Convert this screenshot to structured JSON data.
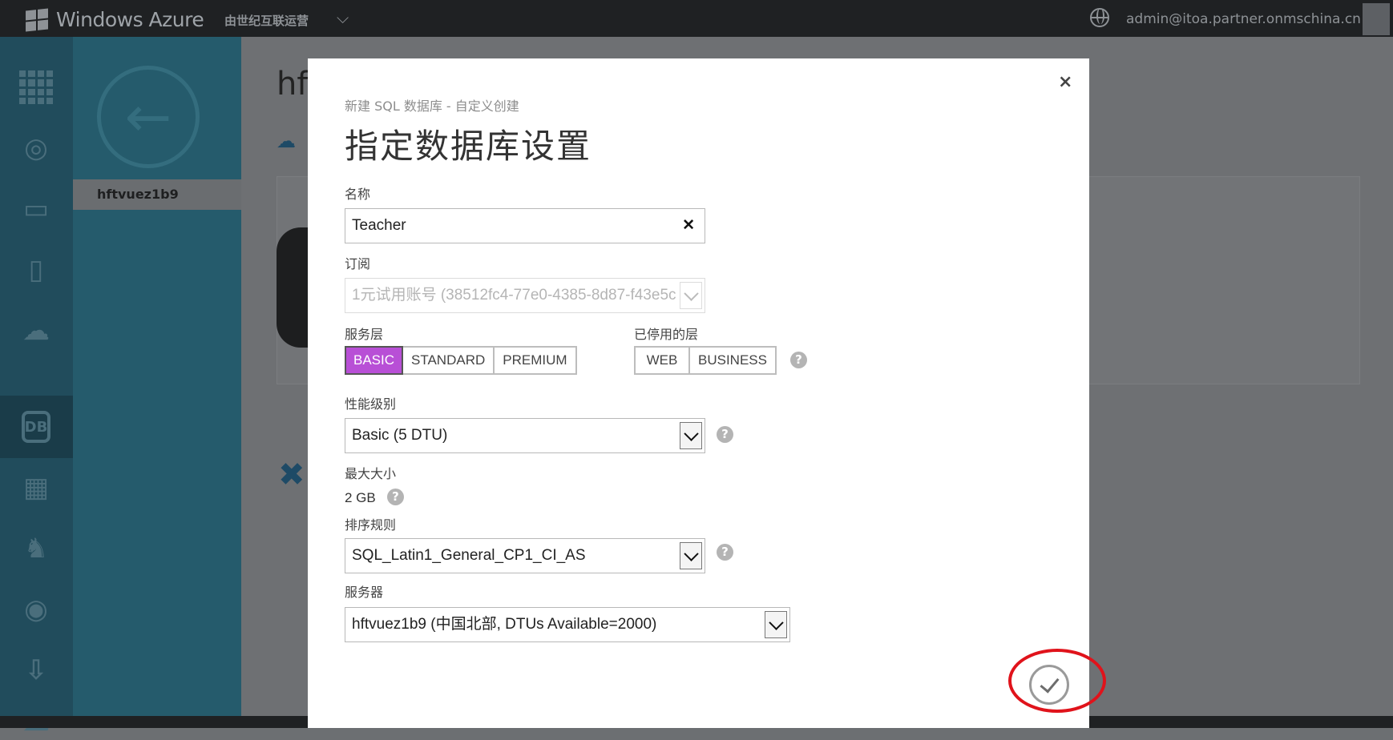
{
  "portal": {
    "brand": "Windows Azure",
    "operator": "由世纪互联运营",
    "user_email": "admin@itoa.partner.onmschina.cn",
    "page_title_partial": "hf",
    "left_panel_item": "hftvuez1b9"
  },
  "dialog": {
    "breadcrumb": "新建 SQL 数据库 - 自定义创建",
    "title": "指定数据库设置",
    "name_label": "名称",
    "name_value": "Teacher",
    "subscription_label": "订阅",
    "subscription_value": "1元试用账号 (38512fc4-77e0-4385-8d87-f43e5c",
    "service_tier_label": "服务层",
    "service_tiers": [
      "BASIC",
      "STANDARD",
      "PREMIUM"
    ],
    "service_tier_selected": "BASIC",
    "retired_tier_label": "已停用的层",
    "retired_tiers": [
      "WEB",
      "BUSINESS"
    ],
    "performance_label": "性能级别",
    "performance_value": "Basic (5 DTU)",
    "max_size_label": "最大大小",
    "max_size_value": "2 GB",
    "collation_label": "排序规则",
    "collation_value": "SQL_Latin1_General_CP1_CI_AS",
    "server_label": "服务器",
    "server_value": "hftvuez1b9 (中国北部, DTUs Available=2000)",
    "help_glyph": "?",
    "close_glyph": "×",
    "clear_glyph": "✕"
  },
  "icons": {
    "close": "close-icon",
    "confirm": "checkmark-icon",
    "help": "help-icon"
  },
  "colors": {
    "accent_selected": "#b84fd6",
    "highlight_ring": "#e0131b",
    "nav_bg": "#214c5c"
  }
}
